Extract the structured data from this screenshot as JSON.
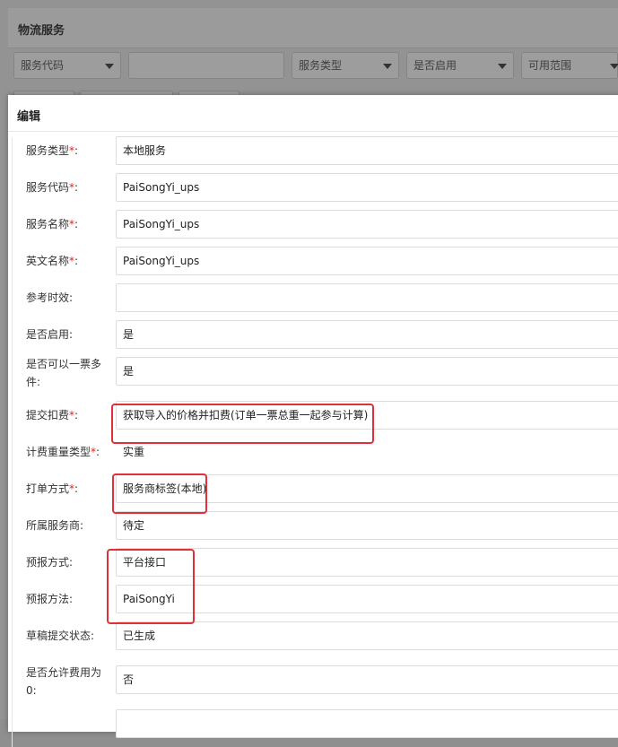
{
  "background": {
    "title": "物流服务",
    "filters": [
      {
        "label": "服务代码",
        "has_caret": true
      },
      {
        "label": "",
        "has_caret": false
      },
      {
        "label": "服务类型",
        "has_caret": true
      },
      {
        "label": "是否启用",
        "has_caret": true
      },
      {
        "label": "可用范围",
        "has_caret": true
      }
    ]
  },
  "modal": {
    "title": "编辑",
    "fields": [
      {
        "label": "服务类型",
        "required": "*",
        "value": "本地服务"
      },
      {
        "label": "服务代码",
        "required": "*",
        "value": "PaiSongYi_ups"
      },
      {
        "label": "服务名称",
        "required": "*",
        "value": "PaiSongYi_ups"
      },
      {
        "label": "英文名称",
        "required": "*",
        "value": "PaiSongYi_ups"
      },
      {
        "label": "参考时效",
        "required": "",
        "value": ""
      },
      {
        "label": "是否启用",
        "required": "",
        "value": "是"
      },
      {
        "label_line1": "是否可以一票多",
        "label_line2": "件",
        "required": "",
        "value": "是"
      },
      {
        "label": "提交扣费",
        "required": "*",
        "value": "获取导入的价格并扣费(订单一票总重一起参与计算)"
      },
      {
        "label": "计费重量类型",
        "required": "*",
        "value": "实重"
      },
      {
        "label": "打单方式",
        "required": "*",
        "value": "服务商标签(本地)"
      },
      {
        "label": "所属服务商",
        "required": "",
        "value": "待定"
      },
      {
        "label": "预报方式",
        "required": "",
        "value": "平台接口"
      },
      {
        "label": "预报方法",
        "required": "",
        "value": "PaiSongYi"
      },
      {
        "label": "草稿提交状态",
        "required": "",
        "value": "已生成"
      },
      {
        "label_line1": "是否允许费用为",
        "label_line2": "0",
        "required": "",
        "value": "否"
      }
    ],
    "colon": ":"
  },
  "colors": {
    "highlight": "#e0313a",
    "required": "#e2231a",
    "overlay": "#939393"
  }
}
